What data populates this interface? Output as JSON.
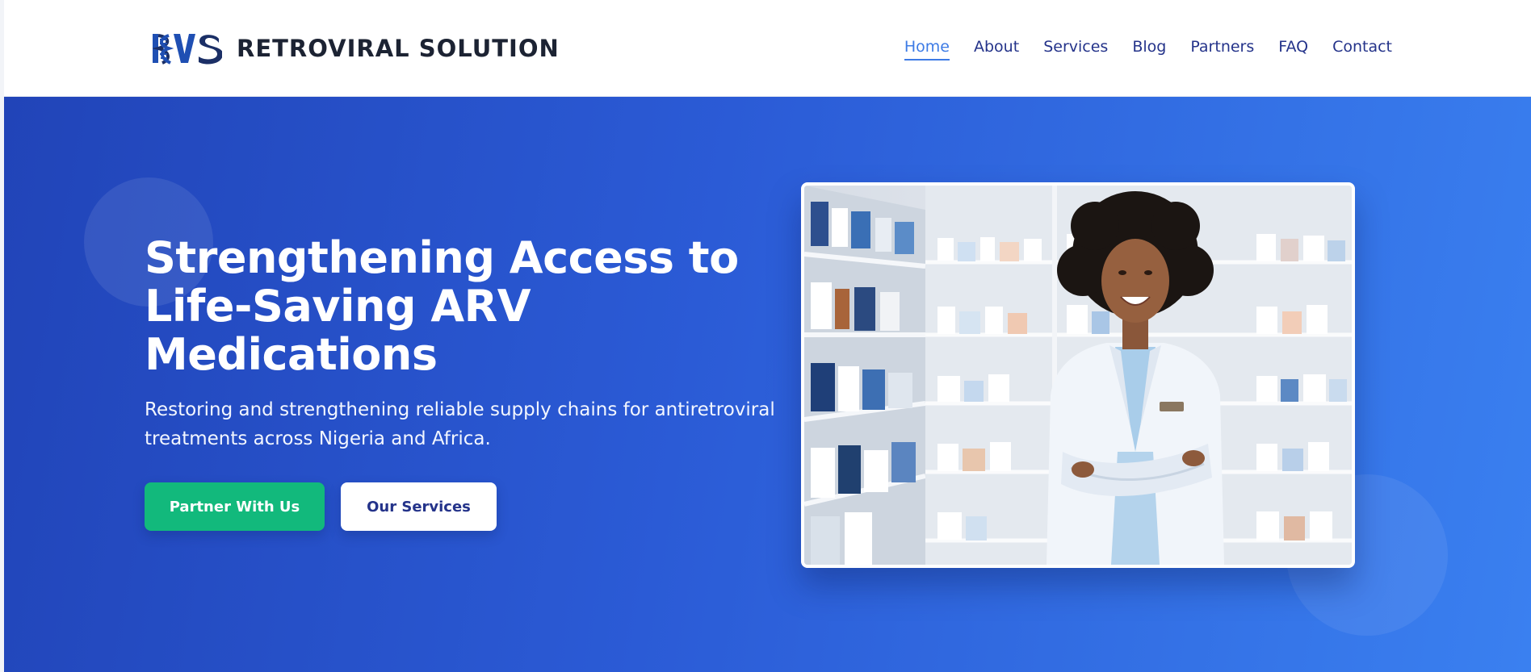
{
  "brand": {
    "logo_text": "RVS",
    "name": "RETROVIRAL SOLUTION",
    "logo_icon": "dna-helix-icon",
    "colors": {
      "logo": "#1f4fb3",
      "logo_dark": "#1b2f66"
    }
  },
  "nav": {
    "items": [
      {
        "label": "Home",
        "active": true
      },
      {
        "label": "About"
      },
      {
        "label": "Services"
      },
      {
        "label": "Blog"
      },
      {
        "label": "Partners"
      },
      {
        "label": "FAQ"
      },
      {
        "label": "Contact"
      }
    ],
    "colors": {
      "link": "#24338a",
      "active": "#3d7be5"
    }
  },
  "hero": {
    "title_line1": "Strengthening Access to",
    "title_line2": "Life-Saving ARV",
    "title_line3": "Medications",
    "subtitle": "Restoring and strengthening reliable supply chains for antiretroviral treatments across Nigeria and Africa.",
    "primary_cta": "Partner With Us",
    "secondary_cta": "Our Services",
    "image_subject": "smiling pharmacist in white coat in front of pharmacy shelves",
    "colors": {
      "gradient_start": "#2144b8",
      "gradient_end": "#3a80f0",
      "primary_button": "#12b97c",
      "secondary_button": "#ffffff"
    }
  }
}
